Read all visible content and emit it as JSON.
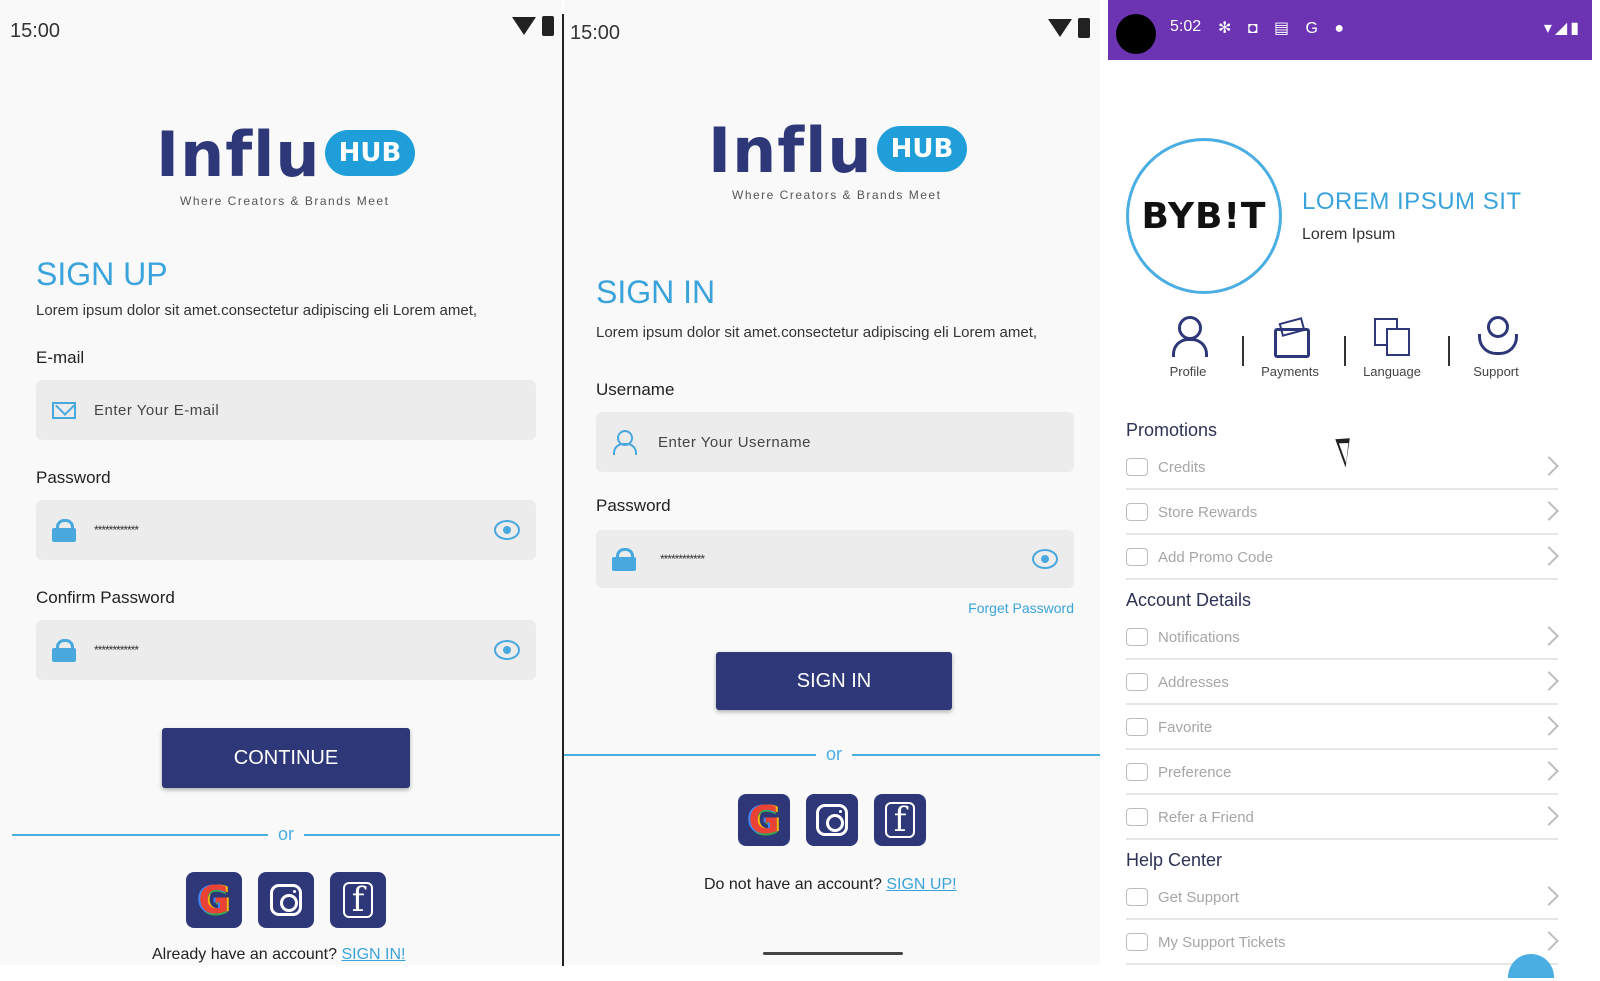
{
  "signup": {
    "time": "15:00",
    "logo_text": "Influ",
    "logo_badge": "HUB",
    "tagline": "Where Creators & Brands Meet",
    "title": "SIGN UP",
    "description": "Lorem ipsum dolor sit amet.consectetur adipiscing eli Lorem amet,",
    "email_label": "E-mail",
    "email_placeholder": "Enter Your E-mail",
    "password_label": "Password",
    "password_value": "************",
    "confirm_label": "Confirm Password",
    "confirm_value": "************",
    "continue_label": "CONTINUE",
    "or_text": "or",
    "footer_text": "Already have an account? ",
    "footer_link": "SIGN IN!"
  },
  "signin": {
    "time": "15:00",
    "logo_text": "Influ",
    "logo_badge": "HUB",
    "tagline": "Where Creators & Brands Meet",
    "title": "SIGN IN",
    "description": "Lorem ipsum dolor sit amet.consectetur adipiscing eli Lorem amet,",
    "username_label": "Username",
    "username_placeholder": "Enter Your Username",
    "password_label": "Password",
    "password_value": "************",
    "forgot_label": "Forget Password",
    "signin_label": "SIGN IN",
    "or_text": "or",
    "footer_text": "Do not have an account? ",
    "footer_link": "SIGN UP!"
  },
  "profile": {
    "status_time": "5:02",
    "status_icons": "✻ ◘ ▤ G ●",
    "status_right": "▾◢▮",
    "avatar_text": "BYB!T",
    "name": "LOREM IPSUM SIT",
    "subtitle": "Lorem Ipsum",
    "quick_actions": [
      {
        "label": "Profile",
        "icon": "person-icon"
      },
      {
        "label": "Payments",
        "icon": "wallet-icon"
      },
      {
        "label": "Language",
        "icon": "translate-icon"
      },
      {
        "label": "Support",
        "icon": "support-icon"
      }
    ],
    "sections": [
      {
        "title": "Promotions",
        "items": [
          "Credits",
          "Store Rewards",
          "Add Promo Code"
        ]
      },
      {
        "title": "Account Details",
        "items": [
          "Notifications",
          "Addresses",
          "Favorite",
          "Preference",
          "Refer a Friend"
        ]
      },
      {
        "title": "Help Center",
        "items": [
          "Get Support",
          "My Support Tickets"
        ]
      }
    ]
  },
  "colors": {
    "brand_navy": "#2e3878",
    "accent_blue": "#3aa3db",
    "status_purple": "#6c33b3"
  }
}
